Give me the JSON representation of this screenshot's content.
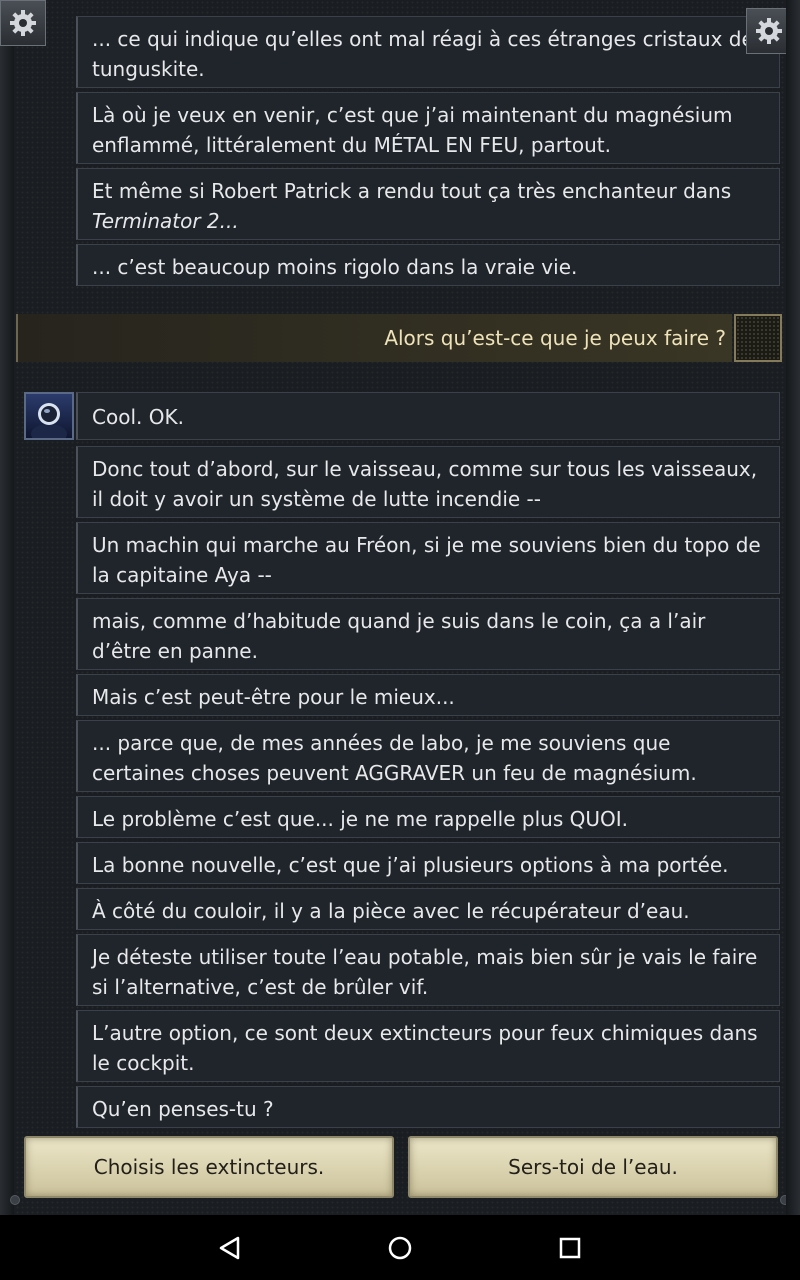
{
  "messages_top": [
    "... ce qui indique qu’elles ont mal réagi à ces étranges cristaux de tunguskite.",
    "Là où je veux en venir, c’est que j’ai maintenant du magnésium enflammé, littéralement du MÉTAL EN FEU, partout.",
    "Et même si Robert Patrick a rendu tout ça très enchanteur dans",
    "Terminator 2...",
    "... c’est beaucoup moins rigolo dans la vraie vie."
  ],
  "player_reply": "Alors qu’est-ce que je peux faire ?",
  "messages_bottom": [
    "Cool. OK.",
    "Donc tout d’abord, sur le vaisseau, comme sur tous les vaisseaux, il doit y avoir un système de lutte incendie --",
    "Un machin qui marche au Fréon, si je me souviens bien du topo de la capitaine Aya --",
    "mais, comme d’habitude quand je suis dans le coin, ça a l’air d’être en panne.",
    "Mais c’est peut-être pour le mieux...",
    "... parce que, de mes années de labo, je me souviens que certaines choses peuvent AGGRAVER un feu de magnésium.",
    "Le problème c’est que... je ne me rappelle plus QUOI.",
    "La bonne nouvelle, c’est que j’ai plusieurs options à ma portée.",
    "À côté du couloir, il y a la pièce avec le récupérateur d’eau.",
    "Je déteste utiliser toute l’eau potable, mais bien sûr je vais le faire si l’alternative, c’est de brûler vif.",
    "L’autre option, ce sont deux extincteurs pour feux chimiques dans le cockpit.",
    "Qu’en penses-tu ?"
  ],
  "choices": {
    "left": "Choisis les extincteurs.",
    "right": "Sers-toi de l’eau."
  },
  "icons": {
    "settings": "gear-icon",
    "back": "back-triangle-icon",
    "home": "home-circle-icon",
    "recents": "recents-square-icon"
  }
}
